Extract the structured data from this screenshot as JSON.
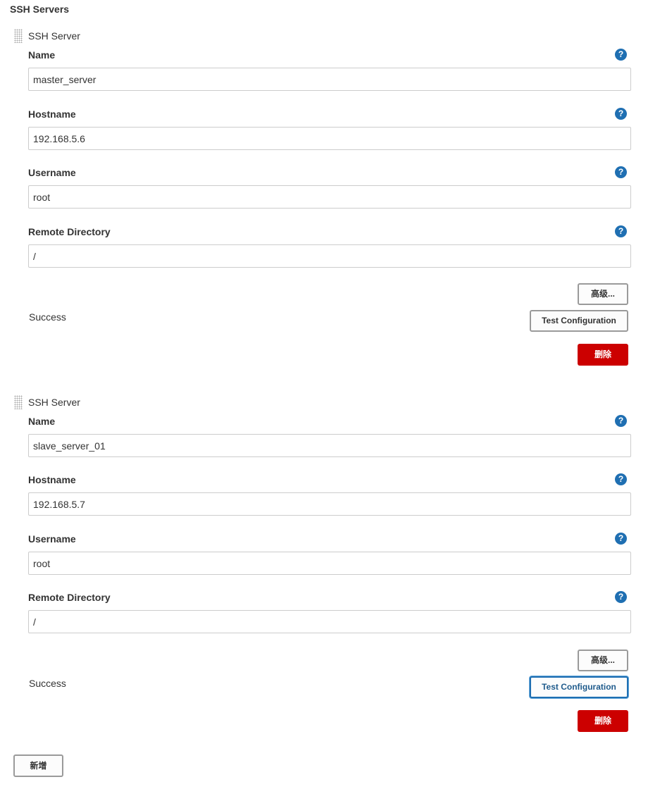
{
  "section": {
    "title": "SSH Servers"
  },
  "servers": [
    {
      "block_title": "SSH Server",
      "fields": {
        "name_label": "Name",
        "name_value": "master_server",
        "hostname_label": "Hostname",
        "hostname_value": "192.168.5.6",
        "username_label": "Username",
        "username_value": "root",
        "remote_dir_label": "Remote Directory",
        "remote_dir_value": "/"
      },
      "advanced_label": "高级...",
      "status_text": "Success",
      "test_label": "Test Configuration",
      "delete_label": "删除"
    },
    {
      "block_title": "SSH Server",
      "fields": {
        "name_label": "Name",
        "name_value": "slave_server_01",
        "hostname_label": "Hostname",
        "hostname_value": "192.168.5.7",
        "username_label": "Username",
        "username_value": "root",
        "remote_dir_label": "Remote Directory",
        "remote_dir_value": "/"
      },
      "advanced_label": "高级...",
      "status_text": "Success",
      "test_label": "Test Configuration",
      "delete_label": "删除"
    }
  ],
  "add_label": "新增",
  "icons": {
    "help": "help-icon",
    "help_glyph": "?",
    "drag": "drag-handle-icon"
  },
  "colors": {
    "help_icon": "#1f6fb2",
    "delete_button": "#cc0000",
    "focus_border": "#1f6fb2"
  }
}
